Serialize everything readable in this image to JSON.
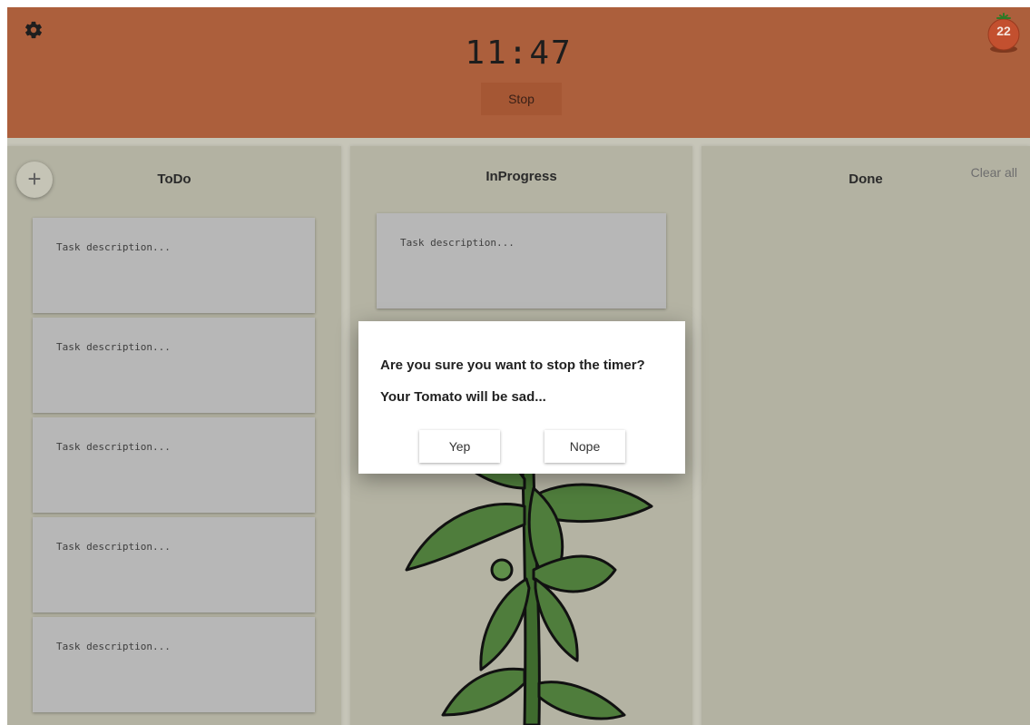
{
  "header": {
    "timer": "11:47",
    "stop_label": "Stop",
    "tomato_count": "22",
    "settings_icon": "gear-icon",
    "tomato_icon": "tomato-icon"
  },
  "columns": {
    "todo": {
      "title": "ToDo",
      "add_label": "+"
    },
    "inprogress": {
      "title": "InProgress"
    },
    "done": {
      "title": "Done",
      "clear_label": "Clear all"
    }
  },
  "task_placeholder": "Task description...",
  "dialog": {
    "question": "Are you sure you want to stop the timer?",
    "subtext": "Your Tomato will be sad...",
    "yes_label": "Yep",
    "no_label": "Nope"
  },
  "colors": {
    "header": "#ac5f3c",
    "board": "#b3b2a2",
    "card": "#b7b7b7",
    "plant_leaf": "#4f7d3c"
  }
}
